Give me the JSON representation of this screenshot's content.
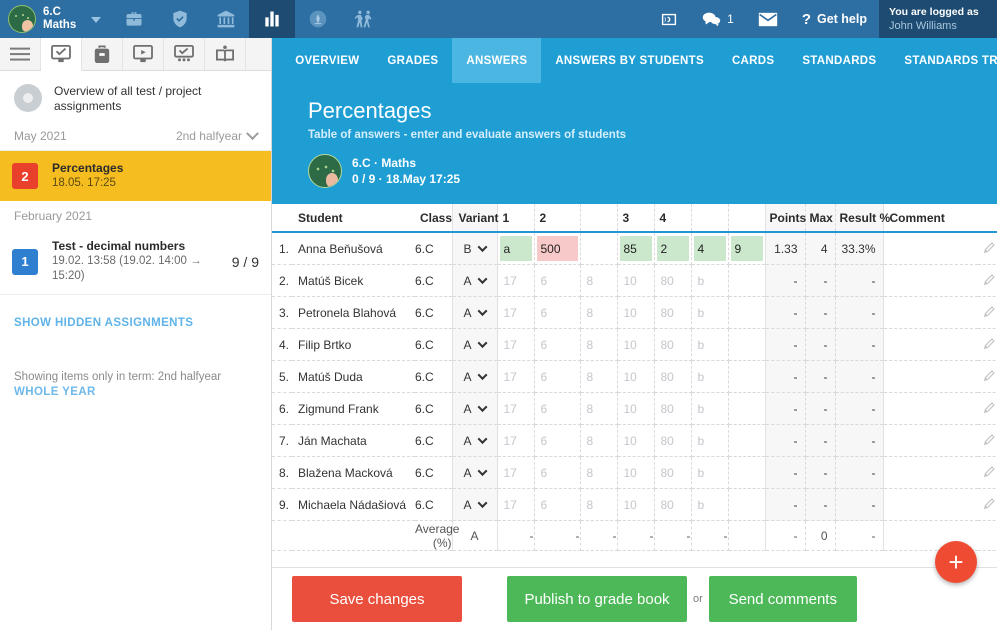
{
  "topbar": {
    "class_line1": "6.C",
    "class_line2": "Maths",
    "icons": [
      "briefcase-icon",
      "shield-icon",
      "bank-icon",
      "chart-bars-icon",
      "compass-icon",
      "walking-people-icon"
    ],
    "notifications_count": "1",
    "help_label": "Get help",
    "logged_as_label": "You are logged as",
    "logged_user": "John Williams"
  },
  "sidebar": {
    "tabs": [
      "menu-icon",
      "assignments-icon",
      "backpack-icon",
      "video-icon",
      "presentation-icon",
      "book-icon"
    ],
    "overview_text": "Overview of all test / project assignments",
    "month_1": "May 2021",
    "halfyear_label": "2nd halfyear",
    "assignments_may": [
      {
        "badge": "2",
        "badge_color": "#e8402a",
        "title": "Percentages",
        "sub": "18.05. 17:25",
        "score": "",
        "highlighted": true
      }
    ],
    "month_2": "February 2021",
    "assignments_feb": [
      {
        "badge": "1",
        "badge_color": "#2f7fd1",
        "title": "Test - decimal numbers",
        "sub": "19.02. 13:58 (19.02. 14:00 → 15:20)",
        "score": "9 / 9",
        "highlighted": false
      }
    ],
    "show_hidden_label": "SHOW HIDDEN ASSIGNMENTS",
    "note": "Showing items only in term: 2nd halfyear",
    "whole_year_label": "WHOLE YEAR"
  },
  "main": {
    "tabs": [
      {
        "label": "OVERVIEW",
        "selected": false
      },
      {
        "label": "GRADES",
        "selected": false
      },
      {
        "label": "ANSWERS",
        "selected": true
      },
      {
        "label": "ANSWERS BY STUDENTS",
        "selected": false
      },
      {
        "label": "CARDS",
        "selected": false
      },
      {
        "label": "STANDARDS",
        "selected": false
      },
      {
        "label": "STANDARDS TREE",
        "selected": false
      }
    ],
    "hero": {
      "title": "Percentages",
      "subtitle": "Table of answers - enter and evaluate answers of students",
      "meta_line1": "6.C · Maths",
      "meta_line2": "0 / 9 · 18.May 17:25"
    },
    "table": {
      "headers": {
        "student": "Student",
        "class": "Class",
        "variant": "Variant",
        "q1": "1",
        "q2": "2",
        "q_blank": "",
        "q3": "3",
        "q4": "4",
        "points": "Points",
        "max": "Max",
        "result": "Result %",
        "comment": "Comment"
      },
      "placeholders": [
        "17",
        "6",
        "8",
        "10",
        "80",
        "b"
      ],
      "rows": [
        {
          "index": "1.",
          "name": "Anna Beňušová",
          "class": "6.C",
          "variant": "B",
          "answers": [
            {
              "value": "a",
              "state": "green"
            },
            {
              "value": "500",
              "state": "red"
            },
            {
              "value": "",
              "state": "empty"
            },
            {
              "value": "85",
              "state": "green"
            },
            {
              "value": "2",
              "state": "green"
            },
            {
              "value": "4",
              "state": "green"
            },
            {
              "value": "9",
              "state": "green"
            }
          ],
          "points": "1.33",
          "max": "4",
          "result": "33.3%",
          "comment": ""
        },
        {
          "index": "2.",
          "name": "Matúš Bicek",
          "class": "6.C",
          "variant": "A",
          "answers": [
            {
              "value": "",
              "state": "empty"
            },
            {
              "value": "",
              "state": "empty"
            },
            {
              "value": "",
              "state": "empty"
            },
            {
              "value": "",
              "state": "empty"
            },
            {
              "value": "",
              "state": "empty"
            },
            {
              "value": "",
              "state": "empty"
            },
            {
              "value": "",
              "state": "empty"
            }
          ],
          "points": "-",
          "max": "-",
          "result": "-",
          "comment": ""
        },
        {
          "index": "3.",
          "name": "Petronela Blahová",
          "class": "6.C",
          "variant": "A",
          "answers": [
            {
              "value": "",
              "state": "empty"
            },
            {
              "value": "",
              "state": "empty"
            },
            {
              "value": "",
              "state": "empty"
            },
            {
              "value": "",
              "state": "empty"
            },
            {
              "value": "",
              "state": "empty"
            },
            {
              "value": "",
              "state": "empty"
            },
            {
              "value": "",
              "state": "empty"
            }
          ],
          "points": "-",
          "max": "-",
          "result": "-",
          "comment": ""
        },
        {
          "index": "4.",
          "name": "Filip Brtko",
          "class": "6.C",
          "variant": "A",
          "answers": [
            {
              "value": "",
              "state": "empty"
            },
            {
              "value": "",
              "state": "empty"
            },
            {
              "value": "",
              "state": "empty"
            },
            {
              "value": "",
              "state": "empty"
            },
            {
              "value": "",
              "state": "empty"
            },
            {
              "value": "",
              "state": "empty"
            },
            {
              "value": "",
              "state": "empty"
            }
          ],
          "points": "-",
          "max": "-",
          "result": "-",
          "comment": ""
        },
        {
          "index": "5.",
          "name": "Matúš Duda",
          "class": "6.C",
          "variant": "A",
          "answers": [
            {
              "value": "",
              "state": "empty"
            },
            {
              "value": "",
              "state": "empty"
            },
            {
              "value": "",
              "state": "empty"
            },
            {
              "value": "",
              "state": "empty"
            },
            {
              "value": "",
              "state": "empty"
            },
            {
              "value": "",
              "state": "empty"
            },
            {
              "value": "",
              "state": "empty"
            }
          ],
          "points": "-",
          "max": "-",
          "result": "-",
          "comment": ""
        },
        {
          "index": "6.",
          "name": "Zigmund Frank",
          "class": "6.C",
          "variant": "A",
          "answers": [
            {
              "value": "",
              "state": "empty"
            },
            {
              "value": "",
              "state": "empty"
            },
            {
              "value": "",
              "state": "empty"
            },
            {
              "value": "",
              "state": "empty"
            },
            {
              "value": "",
              "state": "empty"
            },
            {
              "value": "",
              "state": "empty"
            },
            {
              "value": "",
              "state": "empty"
            }
          ],
          "points": "-",
          "max": "-",
          "result": "-",
          "comment": ""
        },
        {
          "index": "7.",
          "name": "Ján Machata",
          "class": "6.C",
          "variant": "A",
          "answers": [
            {
              "value": "",
              "state": "empty"
            },
            {
              "value": "",
              "state": "empty"
            },
            {
              "value": "",
              "state": "empty"
            },
            {
              "value": "",
              "state": "empty"
            },
            {
              "value": "",
              "state": "empty"
            },
            {
              "value": "",
              "state": "empty"
            },
            {
              "value": "",
              "state": "empty"
            }
          ],
          "points": "-",
          "max": "-",
          "result": "-",
          "comment": ""
        },
        {
          "index": "8.",
          "name": "Blažena Macková",
          "class": "6.C",
          "variant": "A",
          "answers": [
            {
              "value": "",
              "state": "empty"
            },
            {
              "value": "",
              "state": "empty"
            },
            {
              "value": "",
              "state": "empty"
            },
            {
              "value": "",
              "state": "empty"
            },
            {
              "value": "",
              "state": "empty"
            },
            {
              "value": "",
              "state": "empty"
            },
            {
              "value": "",
              "state": "empty"
            }
          ],
          "points": "-",
          "max": "-",
          "result": "-",
          "comment": ""
        },
        {
          "index": "9.",
          "name": "Michaela Nádašiová",
          "class": "6.C",
          "variant": "A",
          "answers": [
            {
              "value": "",
              "state": "empty"
            },
            {
              "value": "",
              "state": "empty"
            },
            {
              "value": "",
              "state": "empty"
            },
            {
              "value": "",
              "state": "empty"
            },
            {
              "value": "",
              "state": "empty"
            },
            {
              "value": "",
              "state": "empty"
            },
            {
              "value": "",
              "state": "empty"
            }
          ],
          "points": "-",
          "max": "-",
          "result": "-",
          "comment": ""
        }
      ],
      "average": {
        "label": "Average (%)",
        "variant": "A",
        "answers": [
          "-",
          "-",
          "-",
          "-",
          "-",
          "-",
          ""
        ],
        "points": "-",
        "max": "0",
        "result": "-"
      }
    }
  },
  "footer": {
    "save_label": "Save changes",
    "publish_label": "Publish to grade book",
    "or_label": "or",
    "send_label": "Send comments",
    "fab_label": "+"
  },
  "colors": {
    "topbar": "#2d6ea3",
    "accent": "#1f9ed4",
    "highlight_yellow": "#f5bd1f",
    "red": "#ea4f3d",
    "green": "#4cb857",
    "answer_green": "#cbe8cd",
    "answer_red": "#f8c9c9"
  }
}
